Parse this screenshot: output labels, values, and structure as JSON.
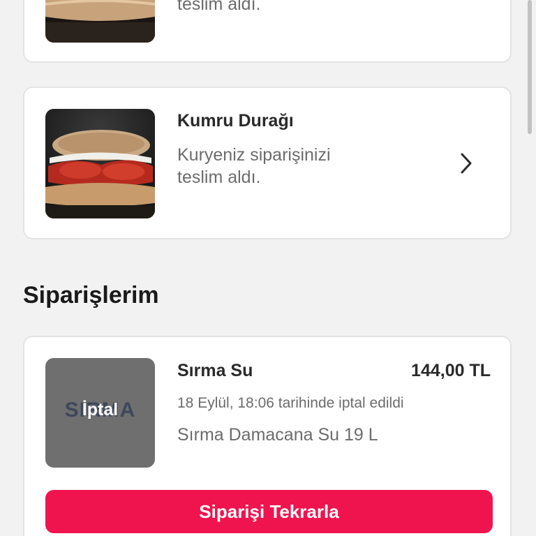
{
  "deliveries": [
    {
      "shop_name": "",
      "status_line1": "",
      "status_line2": "teslim aldı."
    },
    {
      "shop_name": "Kumru Durağı",
      "status_line1": "Kuryeniz siparişinizi",
      "status_line2": "teslim aldı."
    }
  ],
  "orders_section": {
    "title": "Siparişlerim"
  },
  "orders": [
    {
      "shop_name": "Sırma Su",
      "price": "144,00 TL",
      "status": "18 Eylül, 18:06 tarihinde iptal edildi",
      "item": "Sırma Damacana Su 19 L",
      "badge": "İptal",
      "brand_logo_text": "SIRMA",
      "reorder_label": "Siparişi Tekrarla"
    }
  ],
  "colors": {
    "accent": "#f0144e",
    "background": "#f2f2f2",
    "card": "#ffffff",
    "cancelled_overlay": "#6f6f70"
  },
  "icons": {
    "delivery_chevron": "chevron-right-icon"
  }
}
